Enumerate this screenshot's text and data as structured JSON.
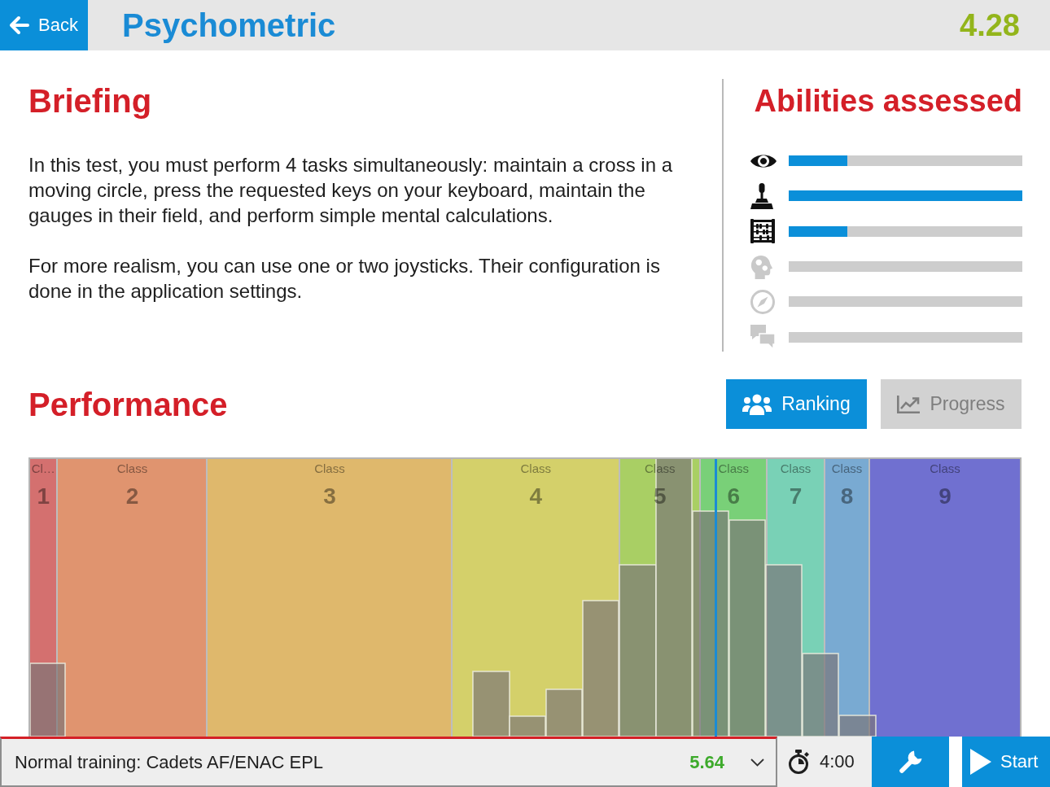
{
  "header": {
    "back_label": "Back",
    "title": "Psychometric",
    "score": "4.28"
  },
  "briefing": {
    "title": "Briefing",
    "paragraphs": [
      "In this test, you must perform 4 tasks simultaneously: maintain a cross in a moving circle, press the requested keys on your keyboard, maintain the gauges in their field, and perform simple mental calculations.",
      "For more realism, you can use one or two joysticks. Their configuration is done in the application settings."
    ]
  },
  "abilities": {
    "title": "Abilities assessed",
    "items": [
      {
        "assessed": true,
        "level": 0.25
      },
      {
        "assessed": true,
        "level": 1
      },
      {
        "assessed": true,
        "level": 0.25
      },
      {
        "assessed": false
      },
      {
        "assessed": false
      },
      {
        "assessed": false
      }
    ]
  },
  "performance": {
    "title": "Performance",
    "tabs": [
      {
        "label": "Ranking",
        "selected": true
      },
      {
        "label": "Progress",
        "selected": false
      }
    ]
  },
  "distribution": {
    "classes": [
      {
        "label": "Cl…",
        "number": "1",
        "color": "#d4706f"
      },
      {
        "label": "Class",
        "number": "2",
        "color": "#e0946f"
      },
      {
        "label": "Class",
        "number": "3",
        "color": "#dfb86c"
      },
      {
        "label": "Class",
        "number": "4",
        "color": "#d4d06a"
      },
      {
        "label": "Class",
        "number": "5",
        "color": "#a9cf64"
      },
      {
        "label": "Class",
        "number": "6",
        "color": "#79d078"
      },
      {
        "label": "Class",
        "number": "7",
        "color": "#79d1b6"
      },
      {
        "label": "Class",
        "number": "8",
        "color": "#79aad2"
      },
      {
        "label": "Class",
        "number": "9",
        "color": "#7070d0"
      }
    ]
  },
  "footer": {
    "training": {
      "name": "Normal training: Cadets AF/ENAC EPL",
      "score": "5.64"
    },
    "timer": "4:00",
    "start_label": "Start"
  }
}
